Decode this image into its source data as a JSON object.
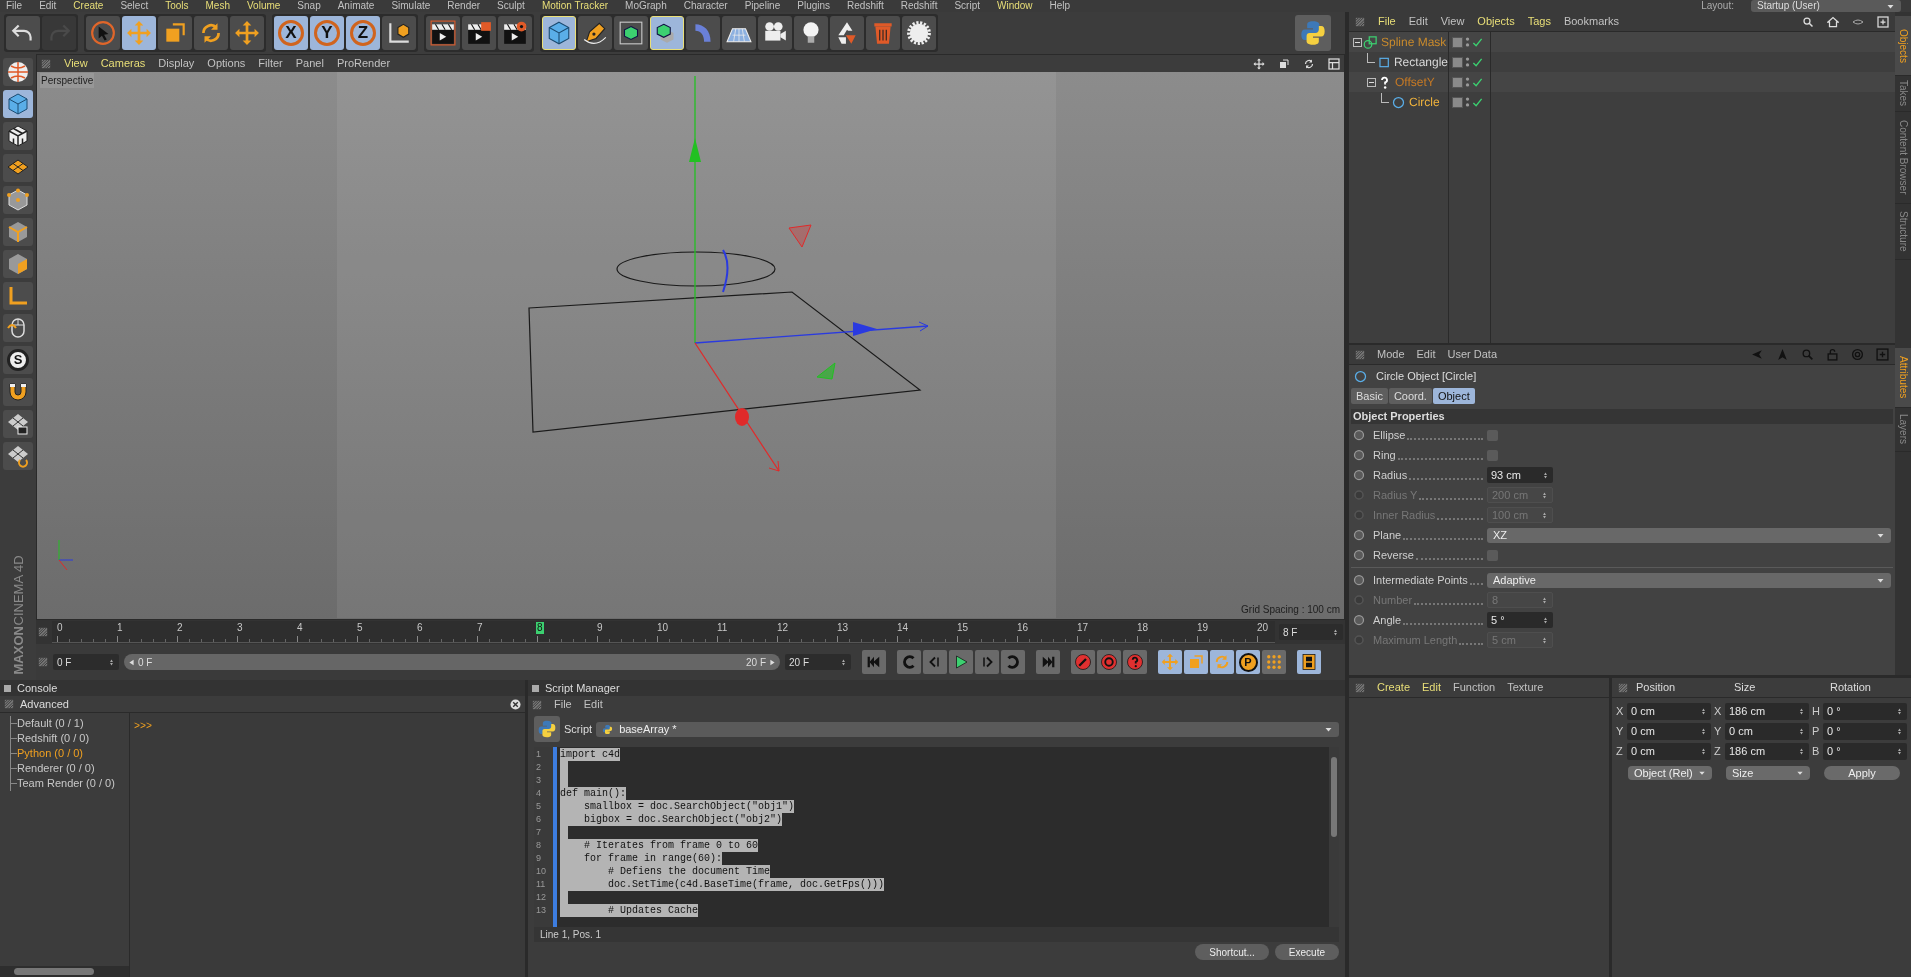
{
  "menu_bar": {
    "items": [
      {
        "label": "File",
        "highlighted": false
      },
      {
        "label": "Edit",
        "highlighted": false
      },
      {
        "label": "Create",
        "highlighted": true
      },
      {
        "label": "Select",
        "highlighted": false
      },
      {
        "label": "Tools",
        "highlighted": true
      },
      {
        "label": "Mesh",
        "highlighted": true
      },
      {
        "label": "Volume",
        "highlighted": true
      },
      {
        "label": "Snap",
        "highlighted": false
      },
      {
        "label": "Animate",
        "highlighted": false
      },
      {
        "label": "Simulate",
        "highlighted": false
      },
      {
        "label": "Render",
        "highlighted": false
      },
      {
        "label": "Sculpt",
        "highlighted": false
      },
      {
        "label": "Motion Tracker",
        "highlighted": true
      },
      {
        "label": "MoGraph",
        "highlighted": false
      },
      {
        "label": "Character",
        "highlighted": false
      },
      {
        "label": "Pipeline",
        "highlighted": false
      },
      {
        "label": "Plugins",
        "highlighted": false
      },
      {
        "label": "Redshift",
        "highlighted": false
      },
      {
        "label": "Redshift",
        "highlighted": false
      },
      {
        "label": "Script",
        "highlighted": false
      },
      {
        "label": "Window",
        "highlighted": true
      },
      {
        "label": "Help",
        "highlighted": false
      }
    ],
    "layout_label": "Layout:",
    "layout_value": "Startup (User)"
  },
  "toolbar": [
    [
      {
        "kind": "undo",
        "selected": false,
        "disabled": false,
        "outlined": false
      },
      {
        "kind": "redo",
        "selected": false,
        "disabled": true,
        "outlined": false
      }
    ],
    [
      {
        "kind": "cursor",
        "selected": false,
        "disabled": false,
        "outlined": false
      },
      {
        "kind": "move",
        "selected": true,
        "disabled": false,
        "outlined": false
      },
      {
        "kind": "scale",
        "selected": false,
        "disabled": false,
        "outlined": false
      },
      {
        "kind": "rotate",
        "selected": false,
        "disabled": false,
        "outlined": false
      },
      {
        "kind": "move",
        "selected": false,
        "disabled": false,
        "outlined": false
      }
    ],
    [
      {
        "kind": "axis",
        "label": "X",
        "selected": true,
        "disabled": false,
        "outlined": false
      },
      {
        "kind": "axis",
        "label": "Y",
        "selected": true,
        "disabled": false,
        "outlined": false
      },
      {
        "kind": "axis",
        "label": "Z",
        "selected": true,
        "disabled": false,
        "outlined": false
      },
      {
        "kind": "world",
        "selected": false,
        "disabled": false,
        "outlined": false
      }
    ],
    [
      {
        "kind": "render_view",
        "selected": false,
        "disabled": false,
        "outlined": false
      },
      {
        "kind": "render_picture",
        "selected": false,
        "disabled": false,
        "outlined": false
      },
      {
        "kind": "render_settings",
        "selected": false,
        "disabled": false,
        "outlined": false
      }
    ],
    [
      {
        "kind": "cube",
        "selected": true,
        "disabled": false,
        "outlined": true
      },
      {
        "kind": "pen",
        "selected": false,
        "disabled": false,
        "outlined": false
      },
      {
        "kind": "subdivision",
        "selected": false,
        "disabled": false,
        "outlined": false
      },
      {
        "kind": "array",
        "selected": true,
        "disabled": false,
        "outlined": true
      },
      {
        "kind": "bend",
        "selected": false,
        "disabled": false,
        "outlined": false
      },
      {
        "kind": "floor",
        "selected": false,
        "disabled": false,
        "outlined": false
      },
      {
        "kind": "camera",
        "selected": false,
        "disabled": false,
        "outlined": false
      },
      {
        "kind": "light",
        "selected": false,
        "disabled": false,
        "outlined": false
      },
      {
        "kind": "recycle",
        "selected": false,
        "disabled": false,
        "outlined": false
      },
      {
        "kind": "trash",
        "selected": false,
        "disabled": false,
        "outlined": false
      },
      {
        "kind": "gear",
        "selected": false,
        "disabled": false,
        "outlined": false
      }
    ]
  ],
  "tools": [
    {
      "kind": "globe",
      "selected": false
    },
    {
      "kind": "cube",
      "selected": true
    },
    {
      "kind": "checker_cube",
      "selected": false
    },
    {
      "kind": "checker_plane",
      "selected": false
    },
    {
      "kind": "point_cube",
      "selected": false
    },
    {
      "kind": "edge_cube",
      "selected": false
    },
    {
      "kind": "polygon_cube",
      "selected": false
    },
    {
      "kind": "axis_corner",
      "selected": false
    },
    {
      "kind": "mouse",
      "selected": false
    },
    {
      "kind": "letter",
      "label": "S",
      "selected": false
    },
    {
      "kind": "magnet",
      "selected": false
    },
    {
      "kind": "locked_grid",
      "selected": false
    },
    {
      "kind": "grid_refresh",
      "selected": false
    }
  ],
  "logo": [
    "MAXON",
    "CINEMA 4D"
  ],
  "viewport": {
    "menu": [
      {
        "label": "View",
        "highlighted": true
      },
      {
        "label": "Cameras",
        "highlighted": true
      },
      {
        "label": "Display",
        "highlighted": false
      },
      {
        "label": "Options",
        "highlighted": false
      },
      {
        "label": "Filter",
        "highlighted": false
      },
      {
        "label": "Panel",
        "highlighted": false
      },
      {
        "label": "ProRender",
        "highlighted": false
      }
    ],
    "camera": "Perspective",
    "grid_spacing": "Grid Spacing : 100 cm"
  },
  "timeline": {
    "ticks": [
      {
        "label": "0",
        "selected": false
      },
      {
        "label": "1",
        "selected": false
      },
      {
        "label": "2",
        "selected": false
      },
      {
        "label": "3",
        "selected": false
      },
      {
        "label": "4",
        "selected": false
      },
      {
        "label": "5",
        "selected": false
      },
      {
        "label": "6",
        "selected": false
      },
      {
        "label": "7",
        "selected": false
      },
      {
        "label": "8",
        "selected": true
      },
      {
        "label": "9",
        "selected": false
      },
      {
        "label": "10",
        "selected": false
      },
      {
        "label": "11",
        "selected": false
      },
      {
        "label": "12",
        "selected": false
      },
      {
        "label": "13",
        "selected": false
      },
      {
        "label": "14",
        "selected": false
      },
      {
        "label": "15",
        "selected": false
      },
      {
        "label": "16",
        "selected": false
      },
      {
        "label": "17",
        "selected": false
      },
      {
        "label": "18",
        "selected": false
      },
      {
        "label": "19",
        "selected": false
      },
      {
        "label": "20",
        "selected": false
      }
    ],
    "current_frame": "8 F",
    "start_frame": "0 F",
    "range": {
      "start": "0 F",
      "end": "20 F"
    },
    "end_frame": "20 F",
    "transport": [
      {
        "kind": "first"
      },
      {
        "kind": "prev_key"
      },
      {
        "kind": "prev_frame"
      },
      {
        "kind": "play"
      },
      {
        "kind": "next_frame"
      },
      {
        "kind": "next_key"
      },
      {
        "kind": "last"
      }
    ],
    "record": [
      {
        "kind": "record"
      },
      {
        "kind": "autokey"
      },
      {
        "kind": "keyframe_selection"
      }
    ],
    "key_tools": [
      {
        "kind": "move",
        "selected": true
      },
      {
        "kind": "scale",
        "selected": true
      },
      {
        "kind": "rotate",
        "selected": true
      },
      {
        "kind": "param",
        "label": "P",
        "selected": true
      },
      {
        "kind": "points",
        "selected": false
      }
    ]
  },
  "objects": {
    "menu": [
      {
        "label": "File",
        "highlighted": true
      },
      {
        "label": "Edit",
        "highlighted": false
      },
      {
        "label": "View",
        "highlighted": false
      },
      {
        "label": "Objects",
        "highlighted": true
      },
      {
        "label": "Tags",
        "highlighted": true
      },
      {
        "label": "Bookmarks",
        "highlighted": false
      }
    ],
    "items": [
      {
        "name": "Spline Mask",
        "kind": "spline_mask",
        "color": "#c88a2c",
        "enabled": true,
        "children": [
          {
            "name": "Rectangle",
            "kind": "rectangle",
            "color": "#d8d8d8",
            "enabled": true
          },
          {
            "name": "OffsetY",
            "kind": "unknown",
            "color": "#c87a24",
            "enabled": true,
            "children": [
              {
                "name": "Circle",
                "kind": "circle",
                "color": "#f2b43c",
                "enabled": true
              }
            ]
          }
        ]
      }
    ]
  },
  "side_tabs_top": [
    {
      "label": "Objects",
      "selected": true
    },
    {
      "label": "Takes",
      "selected": false
    },
    {
      "label": "Content Browser",
      "selected": false
    },
    {
      "label": "Structure",
      "selected": false
    }
  ],
  "side_tabs_bottom": [
    {
      "label": "Attributes",
      "selected": true
    },
    {
      "label": "Layers",
      "selected": false
    }
  ],
  "attributes": {
    "menu": [
      "Mode",
      "Edit",
      "User Data"
    ],
    "title": "Circle Object [Circle]",
    "tabs": [
      {
        "label": "Basic",
        "selected": false
      },
      {
        "label": "Coord.",
        "selected": false
      },
      {
        "label": "Object",
        "selected": true
      }
    ],
    "section": "Object Properties",
    "properties": [
      {
        "kind": "checkbox",
        "label": "Ellipse",
        "checked": false,
        "disabled": false
      },
      {
        "kind": "checkbox",
        "label": "Ring",
        "checked": false,
        "disabled": false
      },
      {
        "kind": "number",
        "label": "Radius",
        "value": "93 cm",
        "disabled": false
      },
      {
        "kind": "number",
        "label": "Radius Y",
        "value": "200 cm",
        "disabled": true
      },
      {
        "kind": "number",
        "label": "Inner Radius",
        "value": "100 cm",
        "disabled": true
      },
      {
        "kind": "dropdown",
        "label": "Plane",
        "value": "XZ",
        "disabled": false
      },
      {
        "kind": "checkbox",
        "label": "Reverse",
        "checked": false,
        "disabled": false
      },
      {
        "kind": "separator"
      },
      {
        "kind": "dropdown",
        "label": "Intermediate Points",
        "value": "Adaptive",
        "disabled": false
      },
      {
        "kind": "number",
        "label": "Number",
        "value": "8",
        "disabled": true
      },
      {
        "kind": "number",
        "label": "Angle",
        "value": "5 °",
        "disabled": false
      },
      {
        "kind": "number",
        "label": "Maximum Length",
        "value": "5 cm",
        "disabled": true
      }
    ]
  },
  "console": {
    "title": "Console",
    "subtitle": "Advanced",
    "channels": [
      {
        "label": "Default (0 / 1)",
        "selected": false
      },
      {
        "label": "Redshift (0 / 0)",
        "selected": false
      },
      {
        "label": "Python (0 / 0)",
        "selected": true
      },
      {
        "label": "Renderer (0 / 0)",
        "selected": false
      },
      {
        "label": "Team Render  (0 / 0)",
        "selected": false
      }
    ],
    "prompt": ">>>"
  },
  "script_manager": {
    "title": "Script Manager",
    "menu": [
      "File",
      "Edit"
    ],
    "script_label": "Script",
    "script_name": "baseArray *",
    "lines": [
      {
        "number": "1",
        "code": "import c4d"
      },
      {
        "number": "2"
      },
      {
        "number": "3"
      },
      {
        "number": "4",
        "code": "def main():"
      },
      {
        "number": "5",
        "code": "    smallbox = doc.SearchObject(\"obj1\")"
      },
      {
        "number": "6",
        "code": "    bigbox = doc.SearchObject(\"obj2\")"
      },
      {
        "number": "7"
      },
      {
        "number": "8",
        "code": "    # Iterates from frame 0 to 60"
      },
      {
        "number": "9",
        "code": "    for frame in range(60):"
      },
      {
        "number": "10",
        "code": "        # Defiens the document Time"
      },
      {
        "number": "11",
        "code": "        doc.SetTime(c4d.BaseTime(frame, doc.GetFps()))"
      },
      {
        "number": "12"
      },
      {
        "number": "13",
        "code": "        # Updates Cache"
      }
    ],
    "status": "Line 1, Pos. 1",
    "buttons": [
      "Shortcut...",
      "Execute"
    ]
  },
  "materials": {
    "menu": [
      {
        "label": "Create",
        "highlighted": true
      },
      {
        "label": "Edit",
        "highlighted": true
      },
      {
        "label": "Function",
        "highlighted": false
      },
      {
        "label": "Texture",
        "highlighted": false
      }
    ]
  },
  "coordinates": {
    "headers": [
      "Position",
      "Size",
      "Rotation"
    ],
    "rows": [
      {
        "axis": "X",
        "position": "0 cm",
        "size_axis": "X",
        "size": "186 cm",
        "rotation_axis": "H",
        "rotation": "0 °"
      },
      {
        "axis": "Y",
        "position": "0 cm",
        "size_axis": "Y",
        "size": "0 cm",
        "rotation_axis": "P",
        "rotation": "0 °"
      },
      {
        "axis": "Z",
        "position": "0 cm",
        "size_axis": "Z",
        "size": "186 cm",
        "rotation_axis": "B",
        "rotation": "0 °"
      }
    ],
    "mode": "Object (Rel)",
    "size_mode": "Size",
    "apply": "Apply"
  }
}
